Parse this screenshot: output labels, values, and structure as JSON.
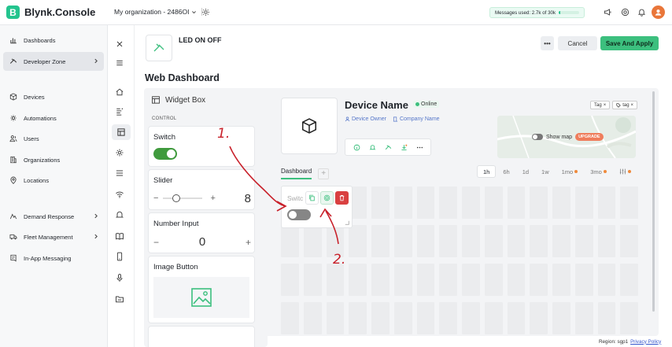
{
  "app": {
    "logo_letter": "B",
    "logo_text": "Blynk.Console"
  },
  "topbar": {
    "org_label": "My organization - 2486OI",
    "messages_text": "Messages used: 2.7k of 30k",
    "messages_fraction": 0.09
  },
  "sidebar": {
    "items": [
      {
        "label": "Dashboards",
        "icon": "bar-chart-icon"
      },
      {
        "label": "Developer Zone",
        "icon": "developer-zone-icon",
        "active": true,
        "chevron": true
      },
      {
        "label": "Devices",
        "icon": "cube-icon"
      },
      {
        "label": "Automations",
        "icon": "automation-icon"
      },
      {
        "label": "Users",
        "icon": "users-icon"
      },
      {
        "label": "Organizations",
        "icon": "building-icon"
      },
      {
        "label": "Locations",
        "icon": "location-pin-icon"
      },
      {
        "label": "Demand Response",
        "icon": "demand-response-icon",
        "chevron": true
      },
      {
        "label": "Fleet Management",
        "icon": "truck-icon",
        "chevron": true
      },
      {
        "label": "In-App Messaging",
        "icon": "message-icon"
      }
    ]
  },
  "header": {
    "template_name": "LED ON OFF",
    "more_label": "•••",
    "cancel_label": "Cancel",
    "save_label": "Save And Apply"
  },
  "page": {
    "title": "Web Dashboard"
  },
  "widget_box": {
    "title": "Widget Box",
    "section": "CONTROL",
    "widgets": {
      "switch": {
        "title": "Switch",
        "state": "on"
      },
      "slider": {
        "title": "Slider",
        "minus": "−",
        "plus": "+",
        "value": "8"
      },
      "number": {
        "title": "Number Input",
        "minus": "−",
        "value": "0",
        "plus": "+"
      },
      "image": {
        "title": "Image Button"
      }
    }
  },
  "device": {
    "name": "Device Name",
    "status": "Online",
    "owner_label": "Device Owner",
    "company_label": "Company Name",
    "tags": [
      "Tag",
      "tag"
    ],
    "map_label": "Show map",
    "upgrade_label": "UPGRADE"
  },
  "dashboard": {
    "tab_label": "Dashboard",
    "add_label": "+",
    "periods": [
      "1h",
      "6h",
      "1d",
      "1w",
      "1mo",
      "3mo"
    ],
    "selected_period": "1h"
  },
  "selected_widget": {
    "title": "Switc",
    "state": "off"
  },
  "annotations": [
    "1.",
    "2."
  ],
  "footer": {
    "region_text": "Region: sgp1",
    "privacy_label": "Privacy Policy"
  },
  "colors": {
    "brand": "#23c48e",
    "save": "#3cbf7e",
    "delete": "#d94040",
    "switch_on": "#3f9a3d",
    "annotation": "#c8202a"
  }
}
